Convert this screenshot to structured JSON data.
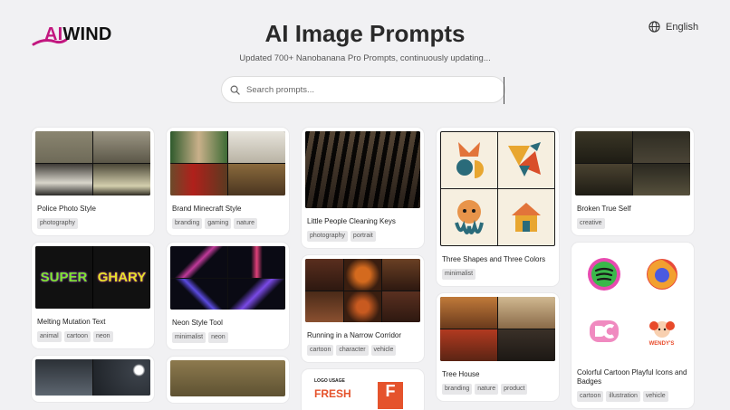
{
  "logo": {
    "prefix": "AI",
    "suffix": "WIND"
  },
  "header": {
    "title": "AI Image Prompts",
    "subtitle": "Updated 700+ Nanobanana Pro Prompts, continuously updating..."
  },
  "language": {
    "label": "English",
    "icon": "globe-icon"
  },
  "search": {
    "placeholder": "Search prompts...",
    "icon": "search-icon"
  },
  "cards": {
    "c1": {
      "title": "Police Photo Style",
      "tags": [
        "photography"
      ]
    },
    "c2": {
      "title": "Melting Mutation Text",
      "tags": [
        "animal",
        "cartoon",
        "neon"
      ]
    },
    "c4": {
      "title": "Brand Minecraft Style",
      "tags": [
        "branding",
        "gaming",
        "nature"
      ]
    },
    "c5": {
      "title": "Neon Style Tool",
      "tags": [
        "minimalist",
        "neon"
      ]
    },
    "c7": {
      "title": "Little People Cleaning Keys",
      "tags": [
        "photography",
        "portrait"
      ]
    },
    "c8": {
      "title": "Running in a Narrow Corridor",
      "tags": [
        "cartoon",
        "character",
        "vehicle"
      ]
    },
    "c9": {
      "logo_text": "LOGO USAGE",
      "sign_text": "FRESH",
      "letter": "F"
    },
    "c10": {
      "title": "Three Shapes and Three Colors",
      "tags": [
        "minimalist"
      ]
    },
    "c11": {
      "title": "Tree House",
      "tags": [
        "branding",
        "nature",
        "product"
      ]
    },
    "c12": {
      "title": "Broken True Self",
      "tags": [
        "creative"
      ]
    },
    "c13": {
      "title": "Colorful Cartoon Playful Icons and Badges",
      "tags": [
        "cartoon",
        "illustration",
        "vehicle"
      ],
      "badge_text": "WENDY'S",
      "melt_words": [
        "SUPER",
        "GHARY"
      ]
    }
  },
  "colors": {
    "accent": "#c2177f",
    "background": "#f1f1f3"
  }
}
